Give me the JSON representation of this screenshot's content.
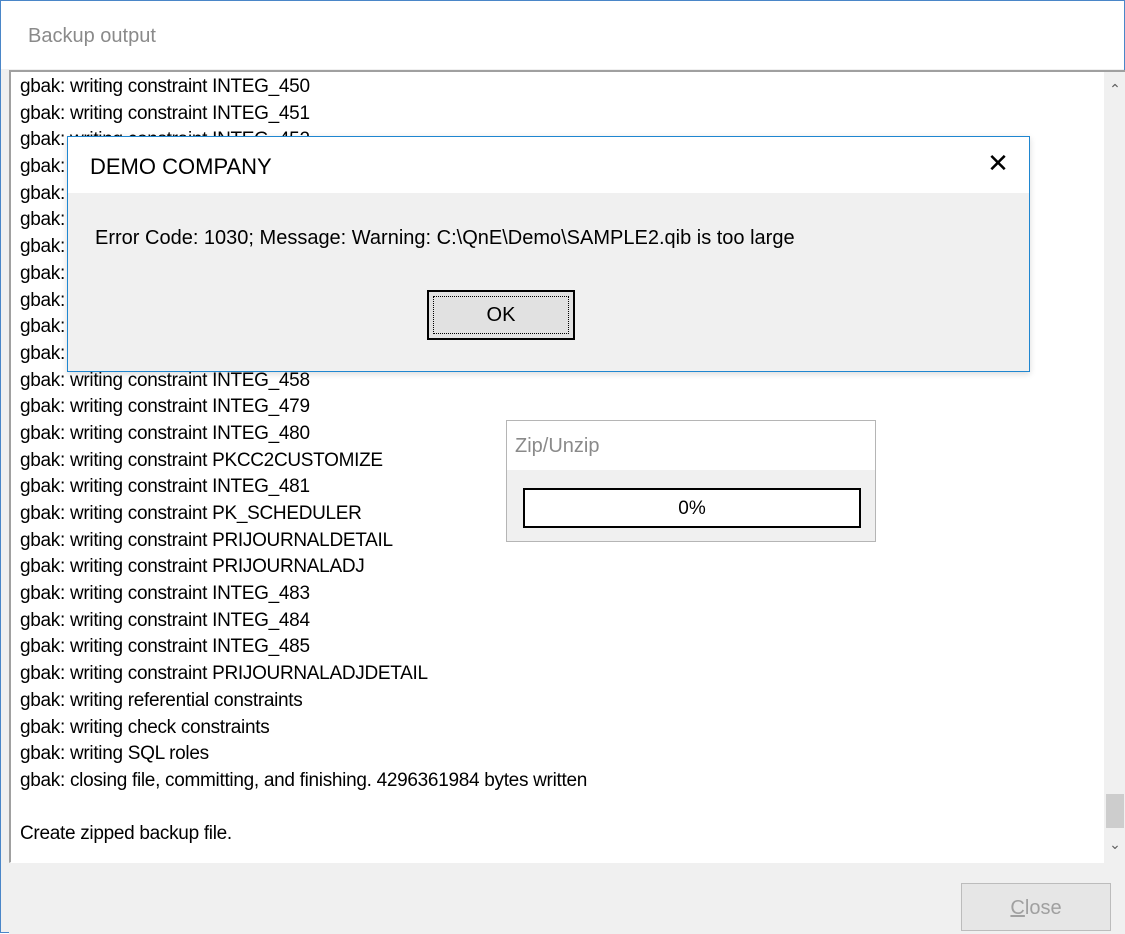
{
  "window": {
    "title": "Backup output",
    "close_button": "Close",
    "close_button_mnemonic": "C",
    "close_button_rest": "lose"
  },
  "log": {
    "lines": [
      "gbak: writing constraint INTEG_450",
      "gbak: writing constraint INTEG_451",
      "gbak: writing constraint INTEG_452",
      "gbak:",
      "gbak:",
      "gbak:",
      "gbak:",
      "gbak:",
      "gbak:",
      "gbak:",
      "gbak:",
      "gbak: writing constraint INTEG_458",
      "gbak: writing constraint INTEG_479",
      "gbak: writing constraint INTEG_480",
      "gbak: writing constraint PKCC2CUSTOMIZE",
      "gbak: writing constraint INTEG_481",
      "gbak: writing constraint PK_SCHEDULER",
      "gbak: writing constraint PRIJOURNALDETAIL",
      "gbak: writing constraint PRIJOURNALADJ",
      "gbak: writing constraint INTEG_483",
      "gbak: writing constraint INTEG_484",
      "gbak: writing constraint INTEG_485",
      "gbak: writing constraint PRIJOURNALADJDETAIL",
      "gbak: writing referential constraints",
      "gbak: writing check constraints",
      "gbak: writing SQL roles",
      "gbak: closing file, committing, and finishing. 4296361984 bytes written",
      "",
      "Create zipped backup file."
    ]
  },
  "scrollbar": {
    "up_icon": "chevron-up-icon",
    "down_icon": "chevron-down-icon"
  },
  "zip_panel": {
    "title": "Zip/Unzip",
    "progress_label": "0%",
    "progress_fraction": 0
  },
  "dialog": {
    "title": "DEMO COMPANY",
    "close_icon": "close-icon",
    "message": "Error Code: 1030; Message: Warning: C:\\QnE\\Demo\\SAMPLE2.qib is too large",
    "ok_label": "OK"
  }
}
